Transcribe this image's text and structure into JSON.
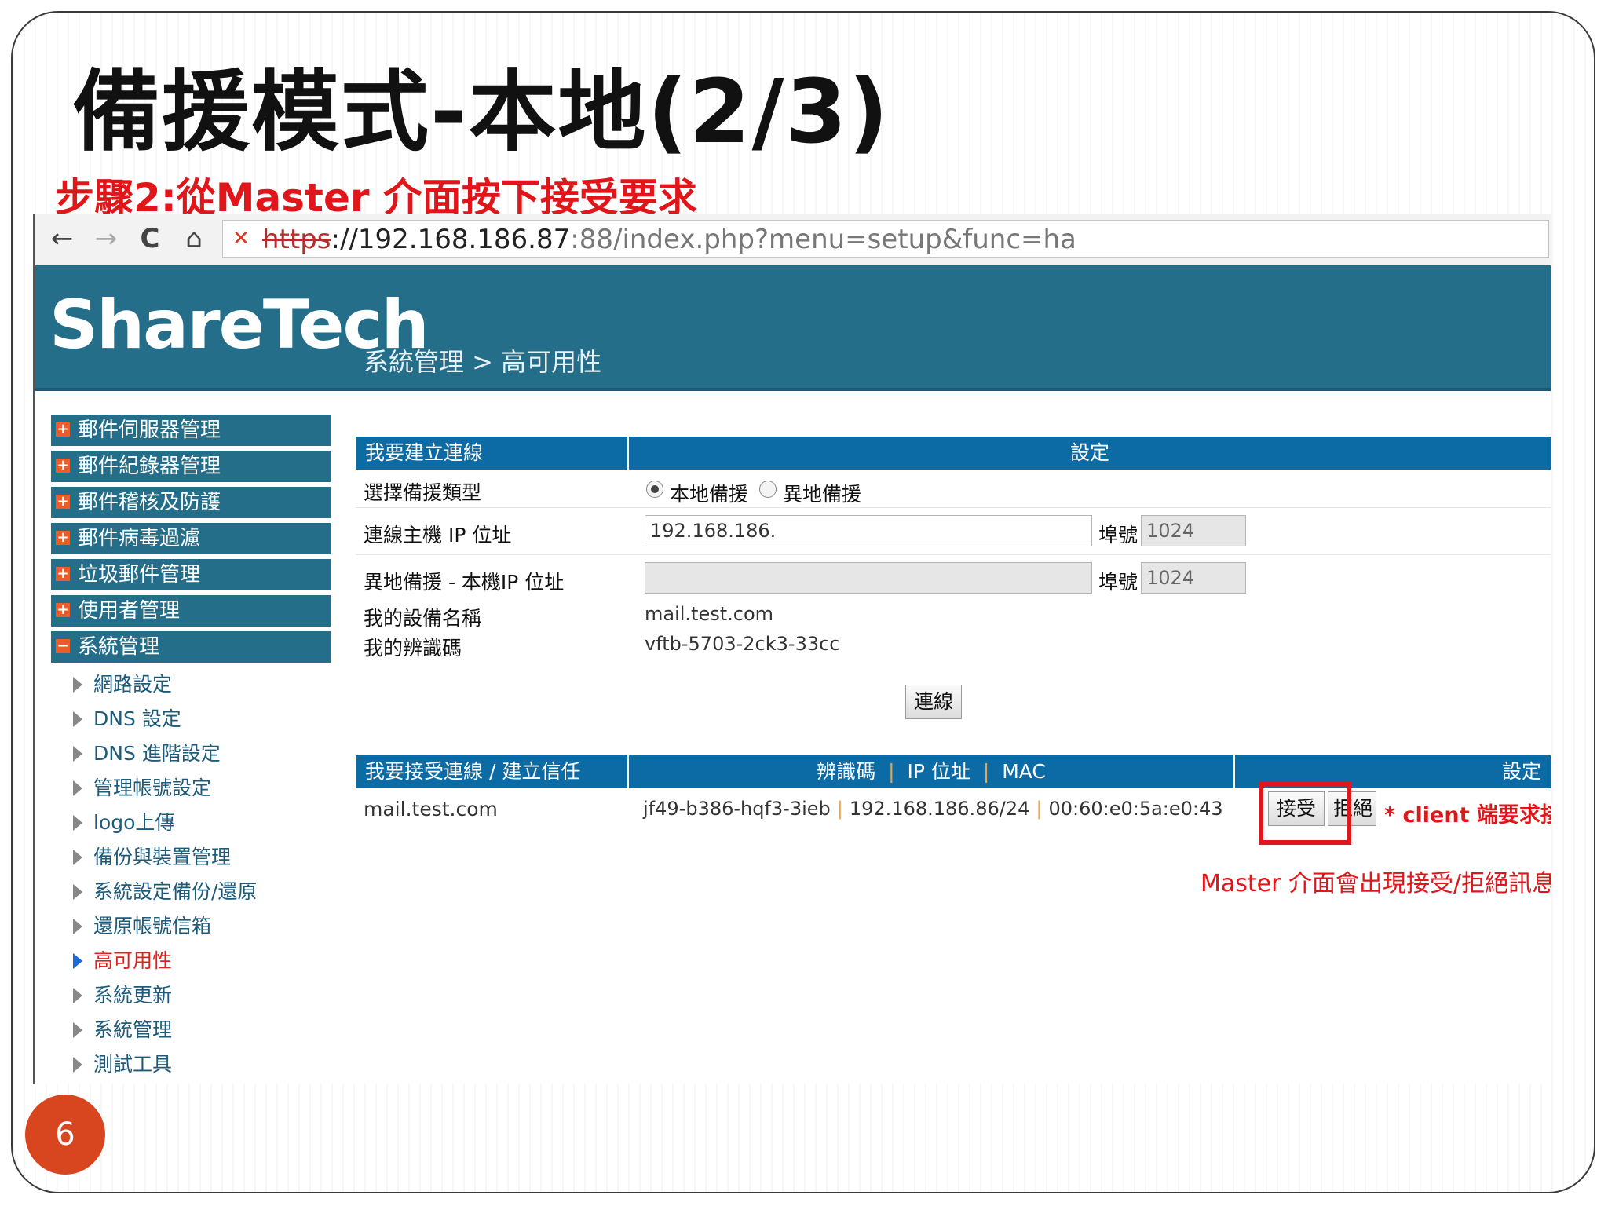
{
  "slide": {
    "title": "備援模式-本地(2/3)",
    "subtitle": "步驟2:從Master 介面按下接受要求",
    "page_number": "6"
  },
  "browser": {
    "back": "←",
    "forward": "→",
    "reload": "C",
    "home": "⌂",
    "url_scheme": "https",
    "url_host": "://192.168.186.87",
    "url_path": ":88/index.php?menu=setup&func=ha"
  },
  "app": {
    "brand": "ShareTech",
    "breadcrumb": "系統管理 > 高可用性"
  },
  "sidebar": {
    "top_items": [
      {
        "label": "郵件伺服器管理",
        "sign": "+"
      },
      {
        "label": "郵件紀錄器管理",
        "sign": "+"
      },
      {
        "label": "郵件稽核及防護",
        "sign": "+"
      },
      {
        "label": "郵件病毒過濾",
        "sign": "+"
      },
      {
        "label": "垃圾郵件管理",
        "sign": "+"
      },
      {
        "label": "使用者管理",
        "sign": "+"
      },
      {
        "label": "系統管理",
        "sign": "−"
      }
    ],
    "sub_items": [
      {
        "label": "網路設定"
      },
      {
        "label": "DNS 設定"
      },
      {
        "label": "DNS 進階設定"
      },
      {
        "label": "管理帳號設定"
      },
      {
        "label": "logo上傳"
      },
      {
        "label": "備份與裝置管理"
      },
      {
        "label": "系統設定備份/還原"
      },
      {
        "label": "還原帳號信箱"
      },
      {
        "label": "高可用性"
      },
      {
        "label": "系統更新"
      },
      {
        "label": "系統管理"
      },
      {
        "label": "測試工具"
      }
    ]
  },
  "connect_panel": {
    "header_left": "我要建立連線",
    "header_right": "設定",
    "rows": {
      "backup_type_label": "選擇備援類型",
      "local_backup": "本地備援",
      "remote_backup": "異地備援",
      "host_ip_label": "連線主機 IP 位址",
      "host_ip_value": "192.168.186.",
      "port_label": "埠號",
      "port_value": "1024",
      "remote_ip_label": "異地備援 - 本機IP 位址",
      "remote_ip_value": "",
      "port2_label": "埠號",
      "port2_value": "1024",
      "device_name_label": "我的設備名稱",
      "device_name_value": "mail.test.com",
      "device_id_label": "我的辨識碼",
      "device_id_value": "vftb-5703-2ck3-33cc"
    },
    "connect_button": "連線"
  },
  "accept_panel": {
    "header_left": "我要接受連線 / 建立信任",
    "header_mid_1": "辨識碼",
    "header_mid_sep": "|",
    "header_mid_2": "IP 位址",
    "header_mid_3": "MAC",
    "header_right": "設定",
    "row": {
      "name": "mail.test.com",
      "id": "jf49-b386-hqf3-3ieb",
      "ip": "192.168.186.86/24",
      "mac": "00:60:e0:5a:e0:43",
      "accept": "接受",
      "reject": "拒絕"
    }
  },
  "annotations": {
    "client_note": "* client 端要求接受",
    "master_note": "Master 介面會出現接受/拒絕訊息"
  },
  "colors": {
    "header_bg": "#246e8a",
    "table_header_bg": "#0c6aa5",
    "highlight_red": "#e0161a",
    "page_badge": "#d8461f"
  }
}
